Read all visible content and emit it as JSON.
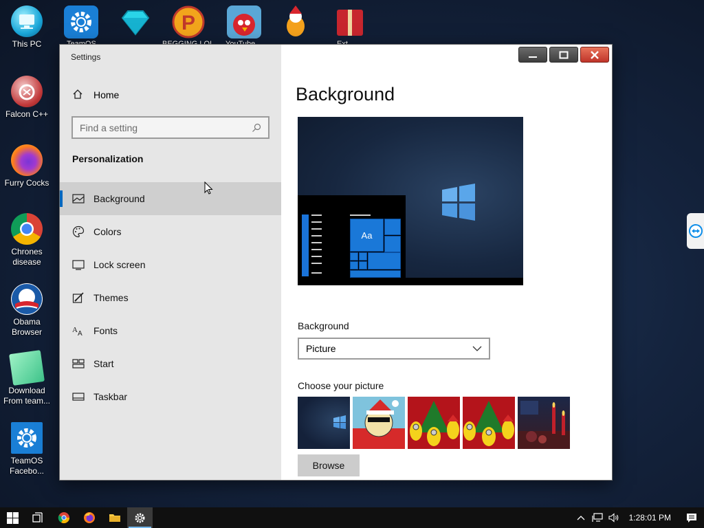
{
  "desktop": {
    "icons": [
      {
        "label": "This PC"
      },
      {
        "label": "Falcon C++"
      },
      {
        "label": "Furry Cocks"
      },
      {
        "label": "Chrones disease"
      },
      {
        "label": "Obama Browser"
      },
      {
        "label": "Download From team..."
      },
      {
        "label": "TeamOS Facebo..."
      }
    ],
    "top_labels": [
      "TeamOS",
      "",
      "BEGGING LOL",
      "YouTube",
      "",
      "Ext"
    ]
  },
  "window": {
    "title": "Settings",
    "controls": {
      "minimize": "—",
      "maximize": "☐",
      "close": "✕"
    }
  },
  "sidebar": {
    "home_label": "Home",
    "search_placeholder": "Find a setting",
    "section_title": "Personalization",
    "items": [
      {
        "label": "Background",
        "icon": "image-icon",
        "active": true
      },
      {
        "label": "Colors",
        "icon": "palette-icon",
        "active": false
      },
      {
        "label": "Lock screen",
        "icon": "lock-screen-icon",
        "active": false
      },
      {
        "label": "Themes",
        "icon": "themes-icon",
        "active": false
      },
      {
        "label": "Fonts",
        "icon": "fonts-icon",
        "active": false
      },
      {
        "label": "Start",
        "icon": "start-icon",
        "active": false
      },
      {
        "label": "Taskbar",
        "icon": "taskbar-icon",
        "active": false
      }
    ]
  },
  "content": {
    "title": "Background",
    "preview_tile_text": "Aa",
    "background_label": "Background",
    "background_value": "Picture",
    "choose_label": "Choose your picture",
    "browse_label": "Browse"
  },
  "taskbar": {
    "clock": "1:28:01 PM"
  },
  "colors": {
    "accent": "#0067c0",
    "tile_blue": "#1a78d8",
    "close_red": "#c0352a"
  }
}
